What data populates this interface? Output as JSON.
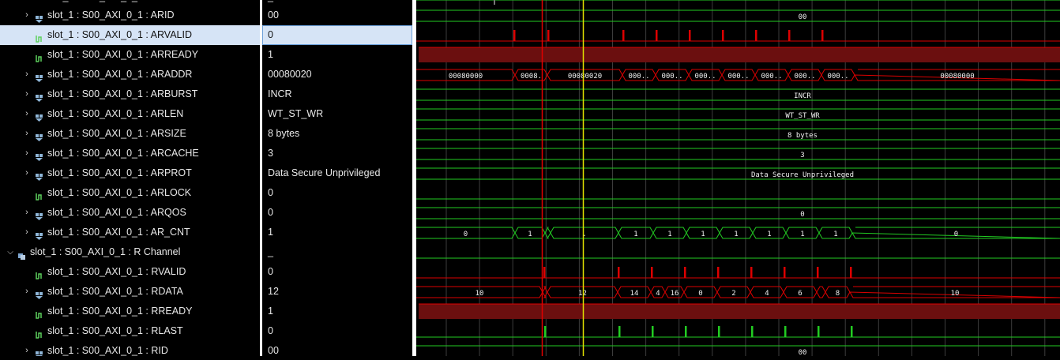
{
  "top_partial": {
    "name_label": "slot_1 : S00_AXI_0_1 : AR...",
    "value": "_"
  },
  "signals": [
    {
      "name": "slot_1 : S00_AXI_0_1 : ARID",
      "value": "00",
      "kind": "bus",
      "indent": 1,
      "expandable": true
    },
    {
      "name": "slot_1 : S00_AXI_0_1 : ARVALID",
      "value": "0",
      "kind": "bit",
      "indent": 1,
      "expandable": false,
      "selected": true
    },
    {
      "name": "slot_1 : S00_AXI_0_1 : ARREADY",
      "value": "1",
      "kind": "bit",
      "indent": 1,
      "expandable": false
    },
    {
      "name": "slot_1 : S00_AXI_0_1 : ARADDR",
      "value": "00080020",
      "kind": "bus",
      "indent": 1,
      "expandable": true
    },
    {
      "name": "slot_1 : S00_AXI_0_1 : ARBURST",
      "value": "INCR",
      "kind": "bus",
      "indent": 1,
      "expandable": true
    },
    {
      "name": "slot_1 : S00_AXI_0_1 : ARLEN",
      "value": "WT_ST_WR",
      "kind": "bus",
      "indent": 1,
      "expandable": true
    },
    {
      "name": "slot_1 : S00_AXI_0_1 : ARSIZE",
      "value": "8 bytes",
      "kind": "bus",
      "indent": 1,
      "expandable": true
    },
    {
      "name": "slot_1 : S00_AXI_0_1 : ARCACHE",
      "value": "3",
      "kind": "bus",
      "indent": 1,
      "expandable": true
    },
    {
      "name": "slot_1 : S00_AXI_0_1 : ARPROT",
      "value": "Data Secure Unprivileged",
      "kind": "bus",
      "indent": 1,
      "expandable": true
    },
    {
      "name": "slot_1 : S00_AXI_0_1 : ARLOCK",
      "value": "0",
      "kind": "bit",
      "indent": 1,
      "expandable": false
    },
    {
      "name": "slot_1 : S00_AXI_0_1 : ARQOS",
      "value": "0",
      "kind": "bus",
      "indent": 1,
      "expandable": true
    },
    {
      "name": "slot_1 : S00_AXI_0_1 : AR_CNT",
      "value": "1",
      "kind": "bus",
      "indent": 1,
      "expandable": true
    },
    {
      "name": "slot_1 : S00_AXI_0_1 : R Channel",
      "value": "_",
      "kind": "group",
      "indent": 0,
      "expandable": true,
      "expanded": true
    },
    {
      "name": "slot_1 : S00_AXI_0_1 : RVALID",
      "value": "0",
      "kind": "bit",
      "indent": 1,
      "expandable": false
    },
    {
      "name": "slot_1 : S00_AXI_0_1 : RDATA",
      "value": "12",
      "kind": "bus",
      "indent": 1,
      "expandable": true
    },
    {
      "name": "slot_1 : S00_AXI_0_1 : RREADY",
      "value": "1",
      "kind": "bit",
      "indent": 1,
      "expandable": false
    },
    {
      "name": "slot_1 : S00_AXI_0_1 : RLAST",
      "value": "0",
      "kind": "bit",
      "indent": 1,
      "expandable": false
    },
    {
      "name": "slot_1 : S00_AXI_0_1 : RID",
      "value": "00",
      "kind": "bus",
      "indent": 1,
      "expandable": true
    }
  ],
  "waves": {
    "arid": {
      "label": "00"
    },
    "araddr": {
      "segments": [
        "00080000",
        "0008.",
        "00080020",
        "000..",
        "000..",
        "000..",
        "000..",
        "000..",
        "000..",
        "000..",
        "000..",
        "00080000"
      ]
    },
    "arburst": {
      "label": "INCR"
    },
    "arlen": {
      "label": "WT_ST_WR"
    },
    "arsize": {
      "label": "8 bytes"
    },
    "arcache": {
      "label": "3"
    },
    "arprot": {
      "label": "Data Secure Unprivileged"
    },
    "arqos": {
      "label": "0"
    },
    "ar_cnt": {
      "segments": [
        "0",
        "1",
        "",
        ".",
        "1",
        "1",
        "1",
        "1",
        "1",
        "1",
        "1",
        "0"
      ]
    },
    "rdata": {
      "segments": [
        "10",
        "",
        "12",
        "14",
        "4",
        "16",
        "0",
        "2",
        "4",
        "6",
        "",
        "8",
        "10"
      ]
    },
    "rid": {
      "label": "00"
    }
  },
  "colors": {
    "grid": "#3c3c3c",
    "bus": "#22cc22",
    "red_signal": "#dd0000",
    "red_band": "#6b0f0f",
    "marker_red": "#e00000",
    "cursor_yellow": "#e0e000",
    "selected_row": "#d6e4f6"
  },
  "icons": {
    "bus": "bus-icon",
    "bit": "bit-icon",
    "group": "group-icon",
    "expand": "chevron-right-icon",
    "collapse": "chevron-down-icon"
  }
}
